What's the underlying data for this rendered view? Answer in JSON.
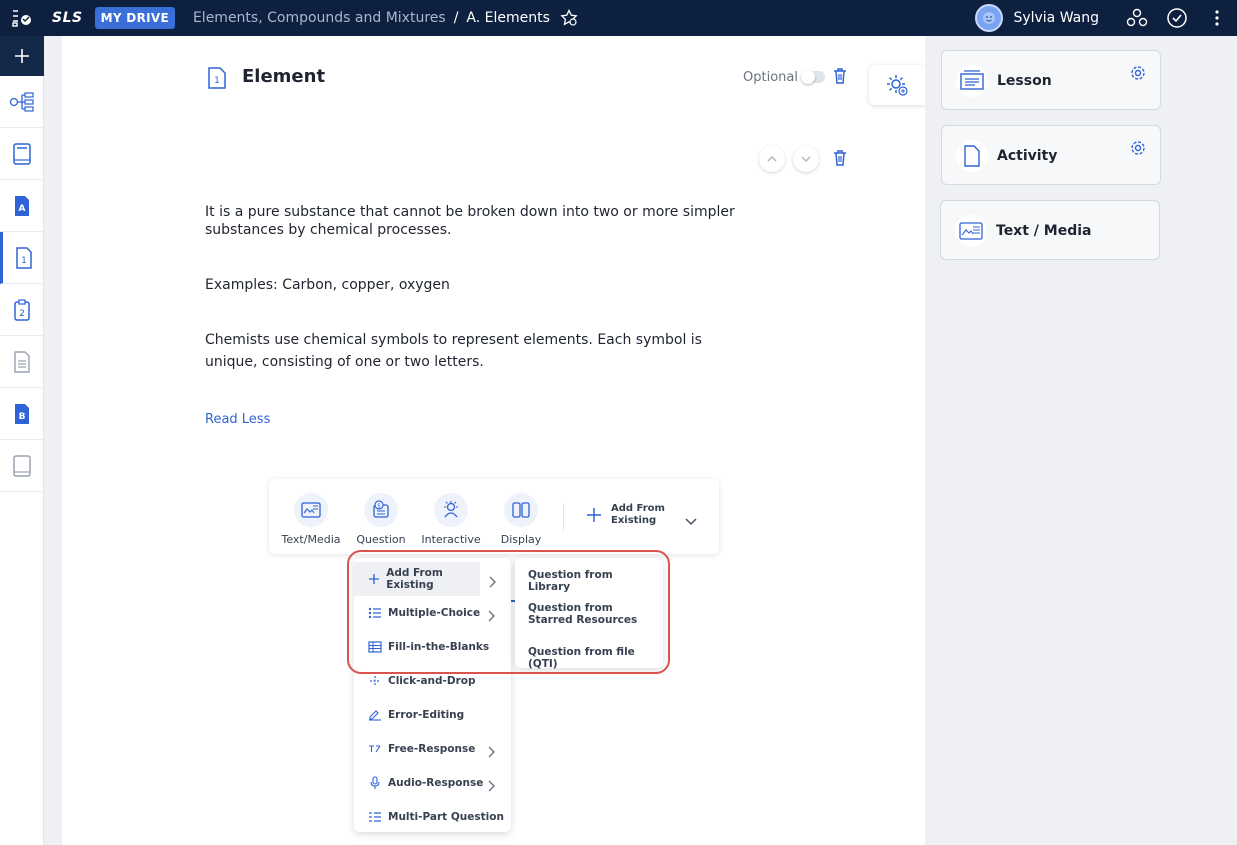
{
  "topbar": {
    "logo": "SLS",
    "drive_label": "MY DRIVE",
    "breadcrumb_parent": "Elements, Compounds and Mixtures",
    "breadcrumb_sep": "/",
    "breadcrumb_current": "A. Elements",
    "user_name": "Sylvia Wang"
  },
  "rail": {
    "items": [
      "network-icon",
      "book-icon",
      "section-a-icon",
      "section-1-icon",
      "section-2-icon",
      "document-icon",
      "section-b-icon",
      "notebook-icon"
    ]
  },
  "element": {
    "badge": "1",
    "title": "Element",
    "optional_label": "Optional",
    "paragraphs": [
      "It is a pure substance that cannot be broken down into two or more simpler substances by chemical processes.",
      "Examples: Carbon, copper, oxygen",
      "Chemists use chemical symbols to represent elements. Each symbol is unique, consisting of one or two letters."
    ],
    "read_less": "Read Less"
  },
  "add_toolbar": {
    "tools": [
      "Text/Media",
      "Question",
      "Interactive",
      "Display"
    ],
    "add_from_existing": "Add From Existing"
  },
  "question_menu": {
    "items": [
      "Add From Existing",
      "Multiple-Choice",
      "Fill-in-the-Blanks",
      "Click-and-Drop",
      "Error-Editing",
      "Free-Response",
      "Audio-Response",
      "Multi-Part Question"
    ]
  },
  "submenu": {
    "items": [
      "Question from Library",
      "Question from Starred Resources",
      "Question from file (QTI)"
    ]
  },
  "right_panel": {
    "cards": [
      "Lesson",
      "Activity",
      "Text / Media"
    ]
  },
  "colors": {
    "topbar": "#0e2040",
    "accent": "#2f63d6",
    "highlight": "#d9534f"
  }
}
